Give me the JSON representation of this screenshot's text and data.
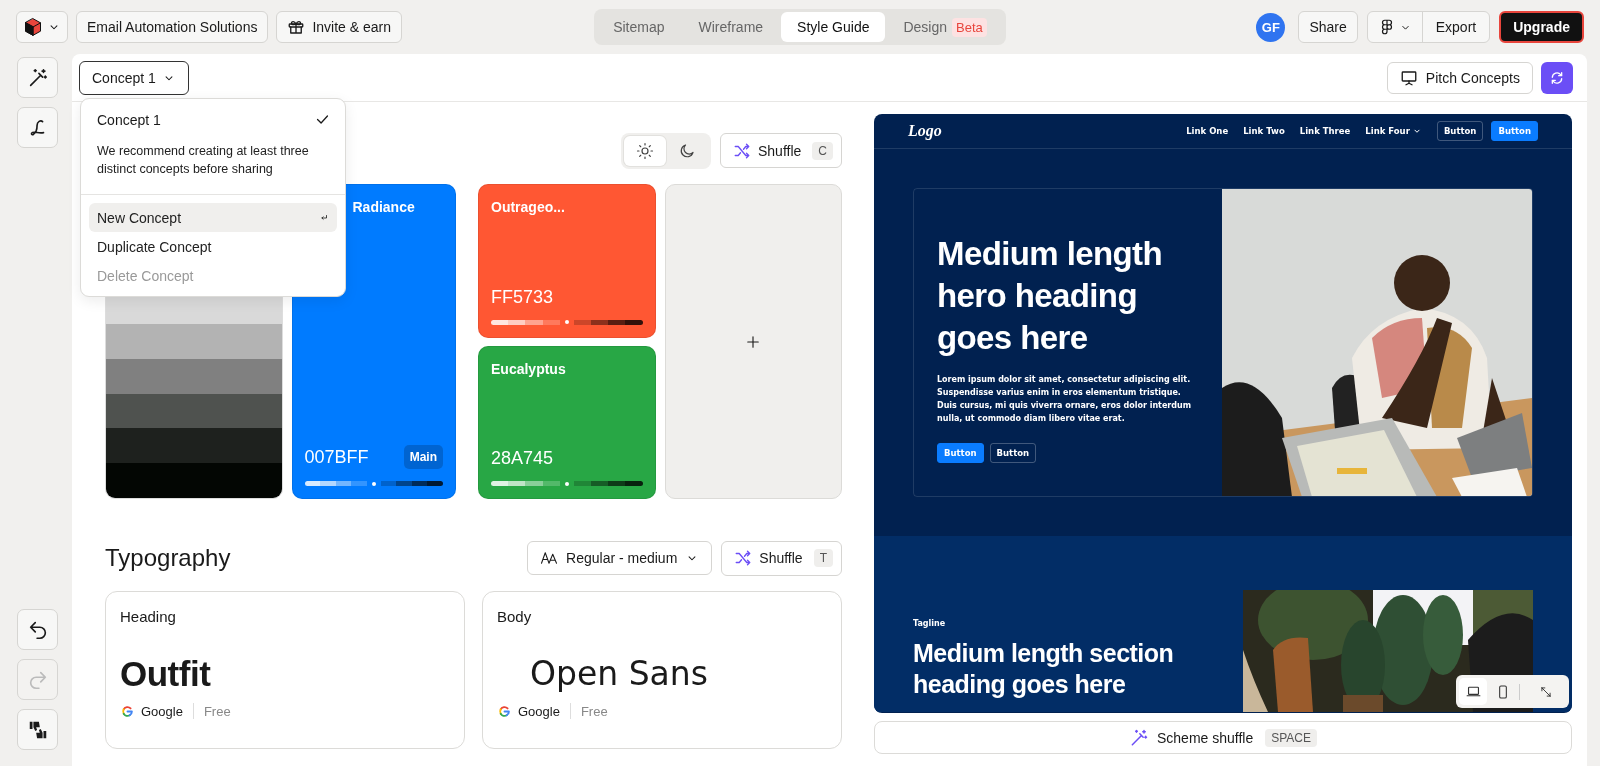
{
  "toolbar": {
    "project": "Email Automation Solutions",
    "invite": "Invite & earn"
  },
  "view_tabs": [
    {
      "label": "Sitemap",
      "selected": false
    },
    {
      "label": "Wireframe",
      "selected": false
    },
    {
      "label": "Style Guide",
      "selected": true
    },
    {
      "label": "Design",
      "badge": "Beta",
      "selected": false
    }
  ],
  "user": {
    "initials": "GF"
  },
  "actions": {
    "share": "Share",
    "export": "Export",
    "upgrade": "Upgrade"
  },
  "side_tools": [
    {
      "kind": "wand",
      "disabled": false
    },
    {
      "kind": "signature",
      "disabled": false
    }
  ],
  "history_tools": [
    {
      "kind": "undo",
      "disabled": false
    },
    {
      "kind": "redo",
      "disabled": true
    },
    {
      "kind": "feedback",
      "disabled": false
    }
  ],
  "concept_selector": {
    "label": "Concept 1",
    "expanded": true
  },
  "concept_menu": {
    "current": {
      "label": "Concept 1",
      "checked": true
    },
    "note": "We recommend creating at least three distinct concepts before sharing",
    "items": [
      {
        "label": "New Concept",
        "selected": true,
        "disabled": false,
        "enter_hint": true
      },
      {
        "label": "Duplicate Concept",
        "selected": false,
        "disabled": false,
        "enter_hint": false
      },
      {
        "label": "Delete Concept",
        "selected": false,
        "disabled": true,
        "enter_hint": false
      }
    ]
  },
  "pitch": "Pitch Concepts",
  "colors": {
    "theme_modes": [
      {
        "kind": "light",
        "selected": true
      },
      {
        "kind": "dark",
        "selected": false
      }
    ],
    "shuffle": {
      "label": "Shuffle",
      "key": "C"
    },
    "cards": [
      {
        "kind": "neutral",
        "shades": [
          {
            "color": "#d9d9d9"
          },
          {
            "color": "#b3b3b3"
          },
          {
            "color": "#808080"
          },
          {
            "color": "#4f524f"
          },
          {
            "color": "#1e211e"
          },
          {
            "color": "#030603"
          }
        ]
      },
      {
        "kind": "main",
        "name": "Radiance",
        "hex": "007BFF",
        "badge": "Main",
        "color": "#007bff"
      },
      {
        "kind": "accent",
        "name": "Outrageo...",
        "hex": "FF5733",
        "color": "#ff5733"
      },
      {
        "kind": "accent",
        "name": "Eucalyptus",
        "hex": "28A745",
        "color": "#28a745"
      },
      {
        "kind": "add"
      }
    ]
  },
  "typography": {
    "title": "Typography",
    "weight": "Regular - medium",
    "shuffle": {
      "label": "Shuffle",
      "key": "T"
    },
    "fonts": [
      {
        "role": "Heading",
        "family": "Outfit",
        "kind": "heading",
        "source": "Google",
        "license": "Free"
      },
      {
        "role": "Body",
        "family": "Open Sans",
        "kind": "body",
        "source": "Google",
        "license": "Free"
      }
    ]
  },
  "preview": {
    "nav": {
      "logo": "Logo",
      "links": [
        {
          "label": "Link One",
          "dropdown": false
        },
        {
          "label": "Link Two",
          "dropdown": false
        },
        {
          "label": "Link Three",
          "dropdown": false
        },
        {
          "label": "Link Four",
          "dropdown": true
        }
      ],
      "buttons": [
        {
          "label": "Button",
          "kind": "secondary"
        },
        {
          "label": "Button",
          "kind": "primary"
        }
      ]
    },
    "hero": {
      "heading": "Medium length hero heading goes here",
      "body": "Lorem ipsum dolor sit amet, consectetur adipiscing elit. Suspendisse varius enim in eros elementum tristique. Duis cursus, mi quis viverra ornare, eros dolor interdum nulla, ut commodo diam libero vitae erat.",
      "buttons": [
        {
          "label": "Button",
          "kind": "primary"
        },
        {
          "label": "Button",
          "kind": "secondary"
        }
      ]
    },
    "section": {
      "tagline": "Tagline",
      "heading": "Medium length section heading goes here"
    },
    "devices": [
      {
        "kind": "desktop",
        "selected": true
      },
      {
        "kind": "mobile",
        "selected": false
      }
    ]
  },
  "scheme_shuffle": {
    "label": "Scheme shuffle",
    "key": "SPACE"
  }
}
